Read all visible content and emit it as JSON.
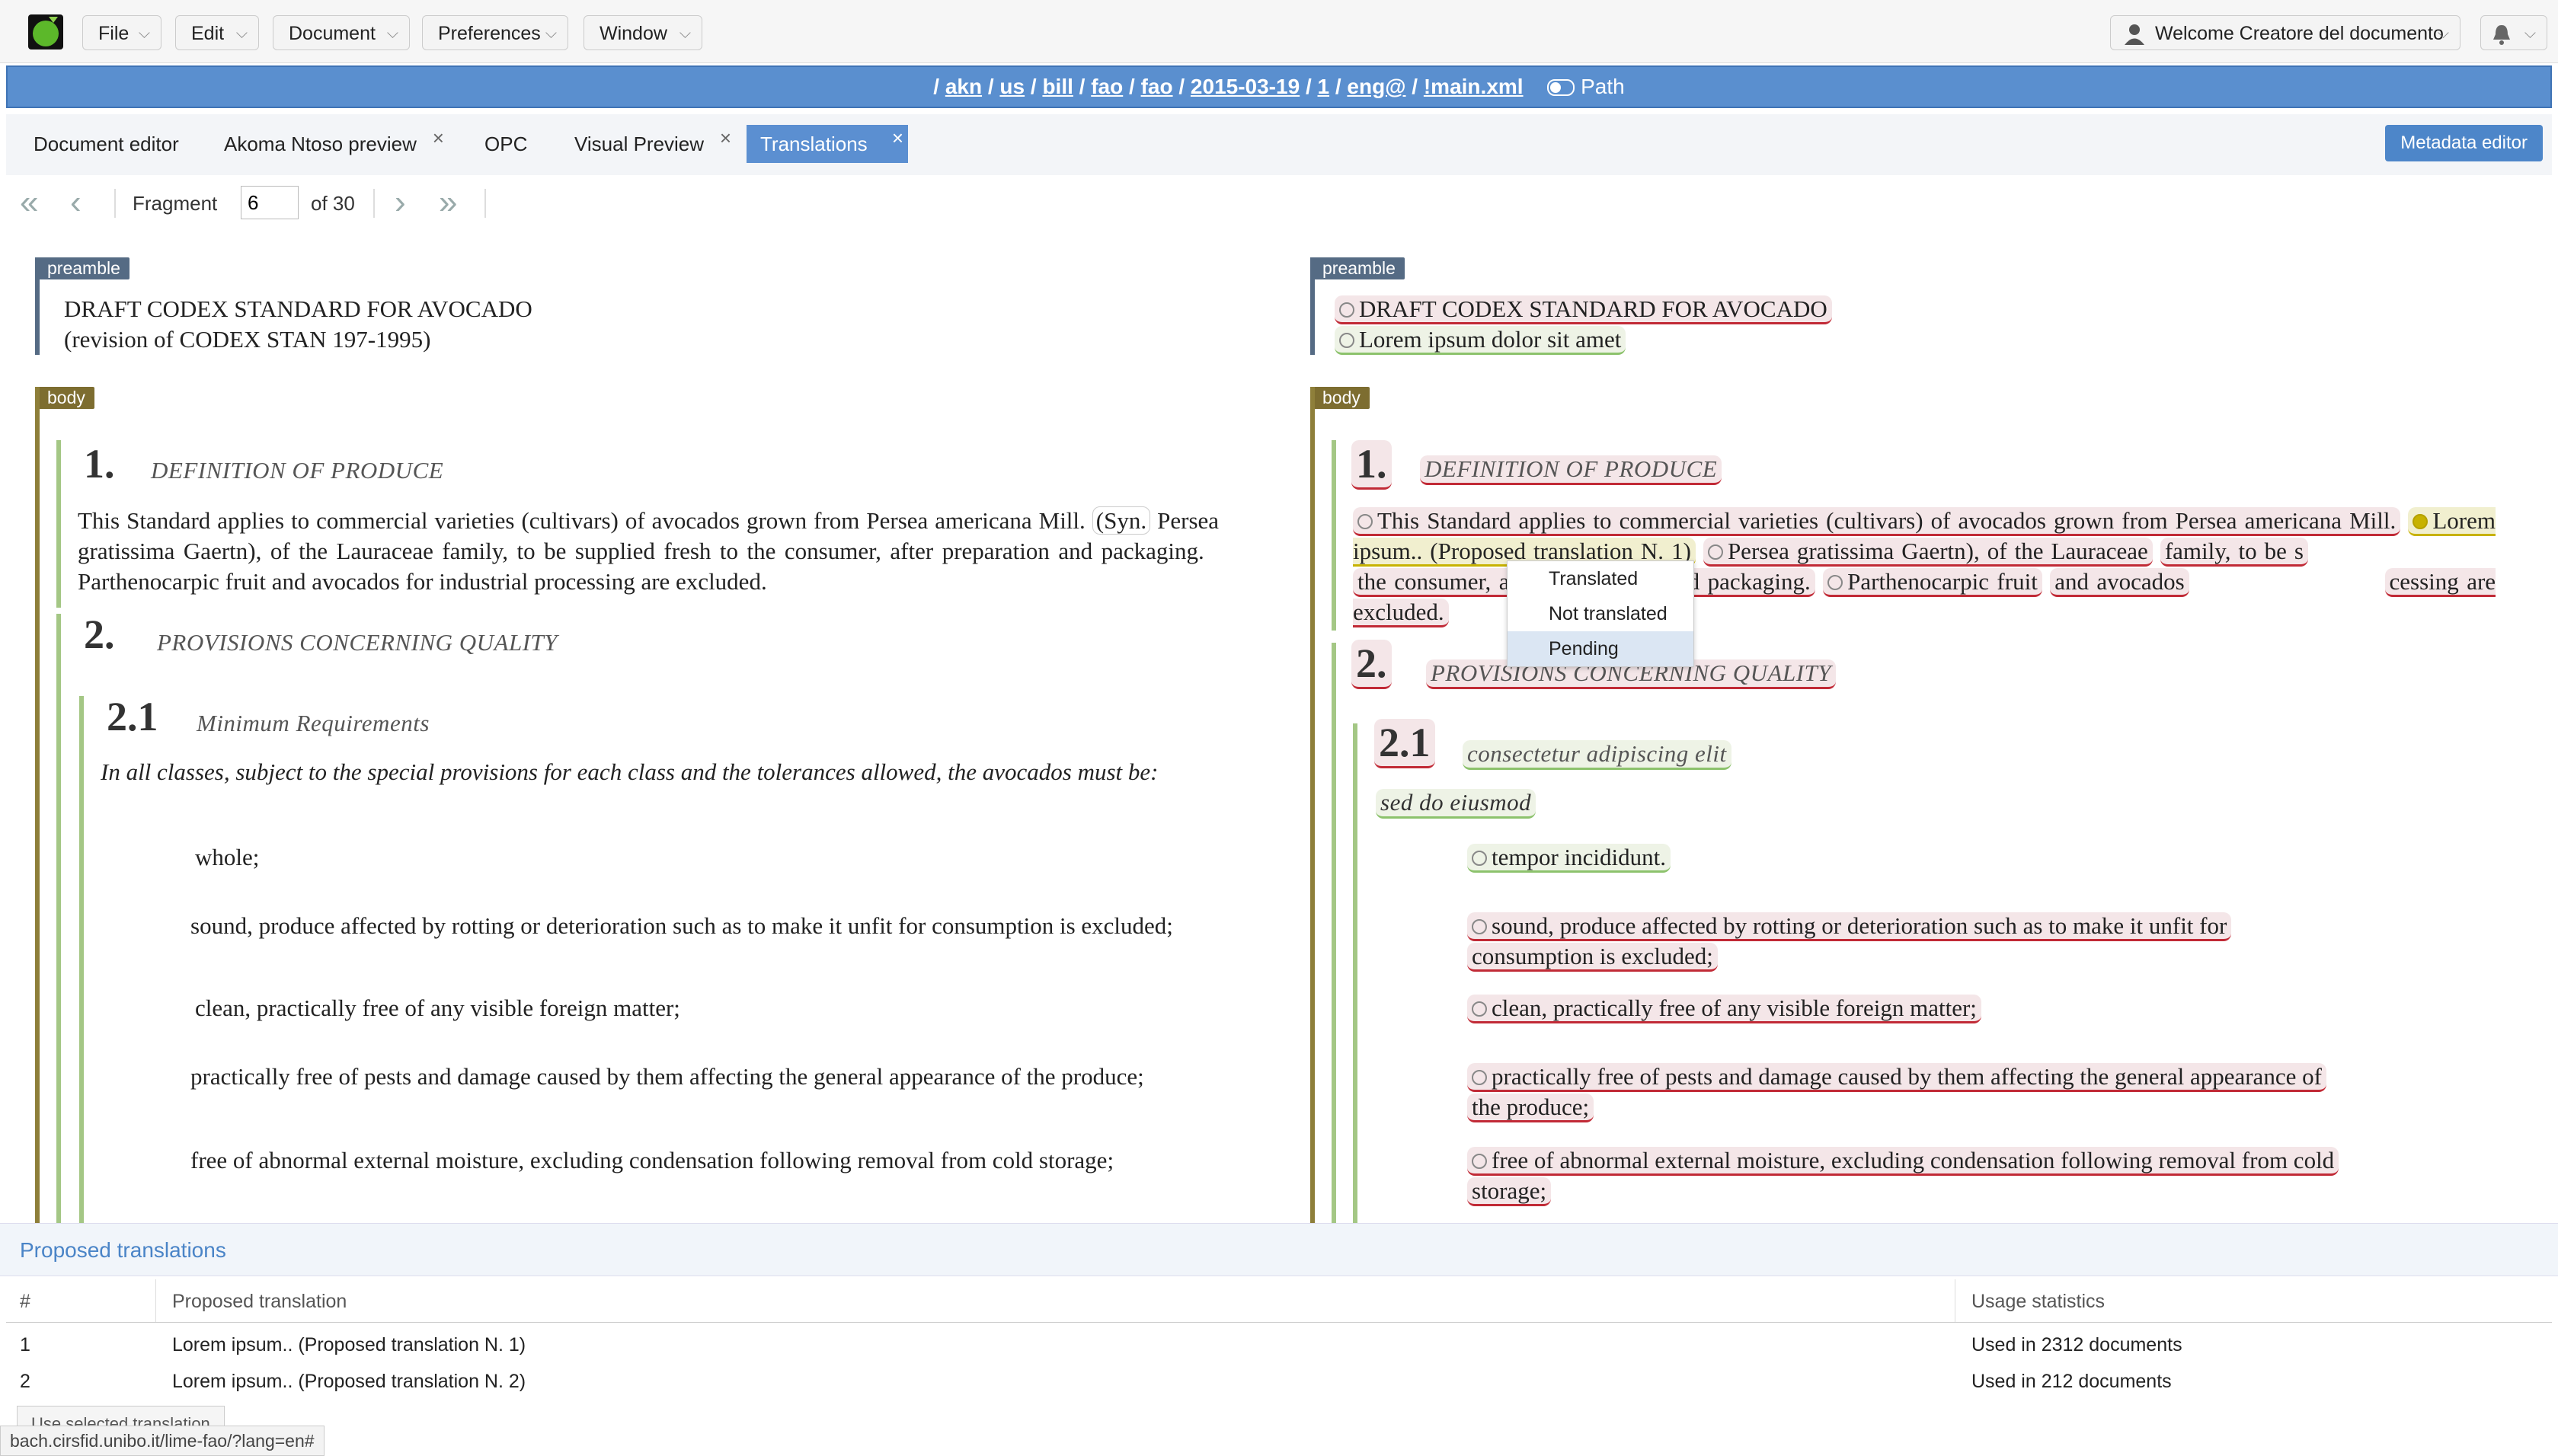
{
  "menu": {
    "file": "File",
    "edit": "Edit",
    "document": "Document",
    "preferences": "Preferences",
    "window": "Window",
    "welcome": "Welcome Creatore del documento"
  },
  "path": {
    "segments": [
      "akn",
      "us",
      "bill",
      "fao",
      "fao",
      "2015-03-19",
      "1",
      "eng@",
      "!main.xml"
    ],
    "toggle_label": "Path"
  },
  "tabs": {
    "document_editor": "Document editor",
    "akoma_ntoso_preview": "Akoma Ntoso preview",
    "opc": "OPC",
    "visual_preview": "Visual Preview",
    "translations": "Translations",
    "close": "×",
    "metadata_editor": "Metadata editor"
  },
  "fragment": {
    "label": "Fragment",
    "value": "6",
    "of": "of 30"
  },
  "left_doc": {
    "preamble_badge": "preamble",
    "preamble_line1": "DRAFT CODEX STANDARD FOR AVOCADO",
    "preamble_line2": "(revision of CODEX STAN 197-1995)",
    "body_badge": "body",
    "s1_num": "1.",
    "s1_heading": "DEFINITION OF PRODUCE",
    "s1_text_a": "This Standard applies to commercial varieties (cultivars) of avocados grown from Persea americana Mill.",
    "s1_syn": "(Syn.",
    "s1_text_b": "Persea gratissima Gaertn), of the Lauraceae family, to be supplied fresh to the consumer, after preparation and packaging.",
    "s1_text_c": "Parthenocarpic fruit and avocados for industrial processing are excluded.",
    "s2_num": "2.",
    "s2_heading": "PROVISIONS CONCERNING QUALITY",
    "s21_num": "2.1",
    "s21_heading": "Minimum Requirements",
    "s21_intro": "In all classes, subject to the special provisions for each class and the tolerances allowed, the avocados must be:",
    "items": [
      "whole;",
      "sound, produce affected by rotting or deterioration such as to make it unfit for consumption is excluded;",
      "clean, practically free of any visible foreign matter;",
      "practically free of pests and damage caused by them affecting the general appearance of the produce;",
      "free of abnormal external moisture, excluding condensation following removal from cold storage;"
    ]
  },
  "right_doc": {
    "preamble_badge": "preamble",
    "preamble_line1": "DRAFT CODEX STANDARD FOR AVOCADO",
    "preamble_line2": "Lorem ipsum dolor sit amet",
    "body_badge": "body",
    "s1_num": "1.",
    "s1_heading": "DEFINITION OF PRODUCE",
    "s1_text_a": "This Standard applies to commercial varieties (cultivars) of avocados grown from Persea americana Mill.",
    "s1_lorem": "Lorem ipsum.. (Proposed translation N. 1)",
    "s1_text_b1": "Persea gratissima Gaertn), of the Lauraceae",
    "s1_text_b2": "family, to be s",
    "s1_text_b3": "the consumer, after preparation and packaging.",
    "s1_text_c1": "Parthenocarpic fruit",
    "s1_text_c2": "and avocados",
    "s1_text_c3": "cessing are excluded.",
    "s2_num": "2.",
    "s2_heading": "PROVISIONS CONCERNING QUALITY",
    "s21_num": "2.1",
    "s21_heading": "consectetur adipiscing elit",
    "s21_intro": "sed do eiusmod",
    "items": [
      "tempor incididunt.",
      "sound, produce affected by rotting or deterioration such as to make it unfit for",
      "consumption is excluded;",
      "clean, practically free of any visible foreign matter;",
      "practically free of pests and damage caused by them affecting the general appearance of",
      "the produce;",
      "free of abnormal external moisture, excluding condensation following removal from cold",
      "storage;"
    ]
  },
  "context_menu": {
    "items": [
      "Translated",
      "Not translated",
      "Pending"
    ]
  },
  "proposed": {
    "title": "Proposed translations",
    "headers": [
      "#",
      "Proposed translation",
      "Usage statistics"
    ],
    "rows": [
      {
        "n": "1",
        "text": "Lorem ipsum.. (Proposed translation N. 1)",
        "usage": "Used in 2312 documents"
      },
      {
        "n": "2",
        "text": "Lorem ipsum.. (Proposed translation N. 2)",
        "usage": "Used in 212 documents"
      }
    ],
    "use_button": "Use selected translation"
  },
  "status_url": "bach.cirsfid.unibo.it/lime-fao/?lang=en#"
}
